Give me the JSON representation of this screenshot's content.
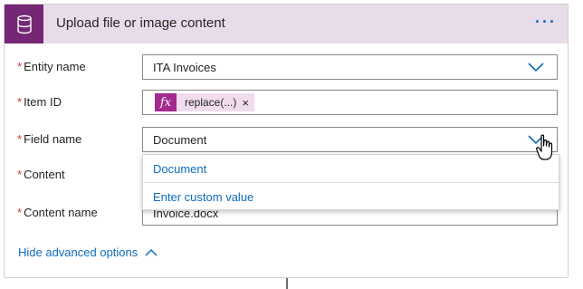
{
  "header": {
    "title": "Upload file or image content",
    "more_label": "···",
    "icon": "database-icon",
    "bg_color": "#e9dcea",
    "icon_bg": "#742774"
  },
  "fields": {
    "entity_name": {
      "label": "Entity name",
      "value": "ITA Invoices"
    },
    "item_id": {
      "label": "Item ID",
      "token_label": "replace(...)",
      "token_fx": "fx",
      "token_remove": "×"
    },
    "field_name": {
      "label": "Field name",
      "value": "Document"
    },
    "content": {
      "label": "Content"
    },
    "content_name": {
      "label": "Content name",
      "value": "Invoice.docx"
    }
  },
  "dropdown": {
    "options": [
      "Document",
      "Enter custom value"
    ]
  },
  "advanced": {
    "label": "Hide advanced options"
  },
  "colors": {
    "accent": "#0f6cbd",
    "required": "#d13438",
    "token_bg": "#f1dcee",
    "fx_bg": "#a4298d"
  }
}
